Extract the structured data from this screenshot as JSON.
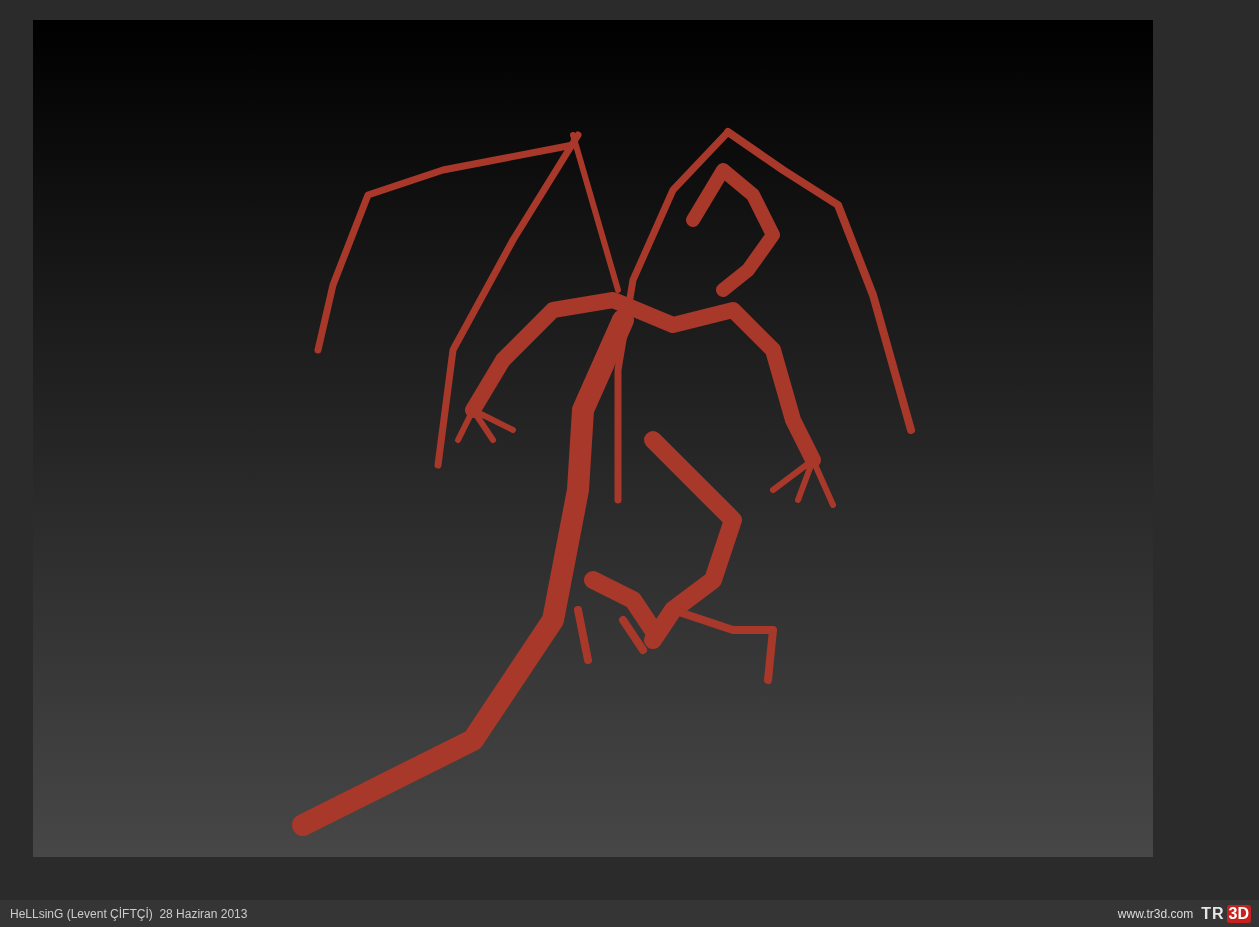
{
  "render": {
    "kind": "sculpt-render"
  },
  "footer": {
    "credit": "HeLLsinG (Levent ÇİFTÇİ)  28 Haziran 2013",
    "site_url": "www.tr3d.com",
    "logo": {
      "left": "TR",
      "right": "3D"
    }
  }
}
